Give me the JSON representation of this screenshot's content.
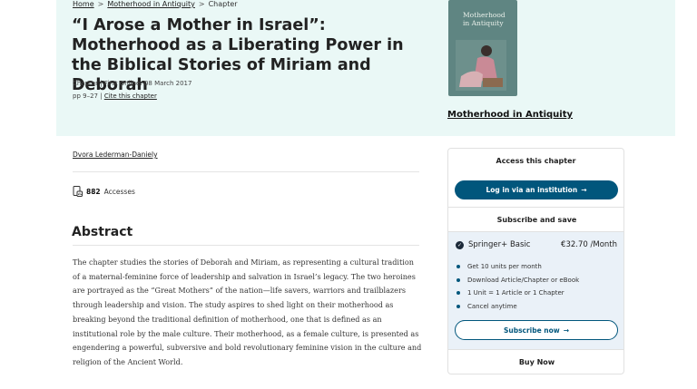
{
  "breadcrumb": {
    "home": "Home",
    "book": "Motherhood in Antiquity",
    "current": "Chapter",
    "separator": ">"
  },
  "chapter": {
    "title": "“I Arose a Mother in Israel”: Motherhood as a Liberating Power in the Biblical Stories of Miriam and Deborah",
    "type": "Chapter",
    "first_online": "First Online: 08 March 2017",
    "pages": "pp 9–27",
    "cite_label": "Cite this chapter",
    "meta_separator": "|"
  },
  "book": {
    "cover_title": "Motherhood in Antiquity",
    "link_label": "Motherhood in Antiquity"
  },
  "author": "Dvora Lederman-Daniely",
  "metrics": {
    "accesses_count": "882",
    "accesses_label": "Accesses",
    "icon": "document-chart-icon"
  },
  "abstract": {
    "heading": "Abstract",
    "text": "The chapter studies the stories of Deborah and Miriam, as representing a cultural tradition of a maternal-feminine force of leadership and salvation in Israel’s legacy. The two heroines are portrayed as the “Great Mothers” of the nation—life savers, warriors and trailblazers through leadership and vision. The study aspires to shed light on their motherhood as breaking beyond the traditional definition of motherhood, one that is defined as an institutional role by the male culture. Their motherhood, as a female culture, is presented as engendering a powerful, subversive and bold revolutionary feminine vision in the culture and religion of the Ancient World."
  },
  "access_panel": {
    "header": "Access this chapter",
    "login_button": "Log in via an institution",
    "subscribe_header": "Subscribe and save",
    "plan_name": "Springer+ Basic",
    "plan_price": "€32.70 /Month",
    "features": [
      "Get 10 units per month",
      "Download Article/Chapter or eBook",
      "1 Unit = 1 Article or 1 Chapter",
      "Cancel anytime"
    ],
    "subscribe_button": "Subscribe now",
    "buy_header": "Buy Now",
    "arrow": "→",
    "check": "✓"
  },
  "colors": {
    "hero_bg": "#eaf8f6",
    "primary": "#01567c",
    "plan_bg": "#eaf1f8"
  }
}
